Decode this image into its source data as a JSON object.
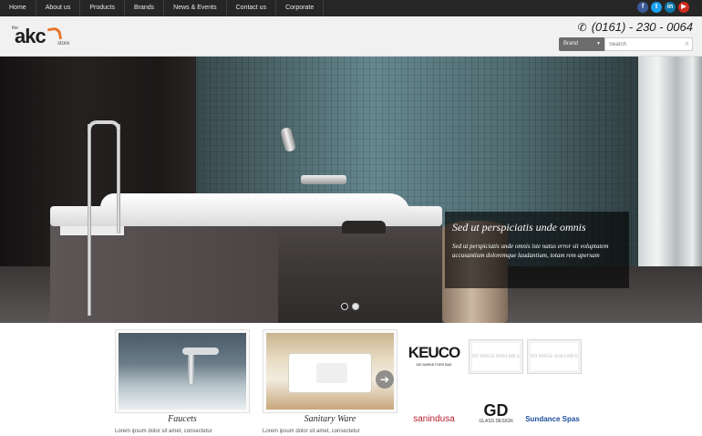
{
  "nav": {
    "items": [
      "Home",
      "About us",
      "Products",
      "Brands",
      "News & Events",
      "Contact us",
      "Corporate"
    ]
  },
  "social": {
    "facebook": "f",
    "twitter": "t",
    "linkedin": "in",
    "youtube": "▶"
  },
  "header": {
    "logo": {
      "the": "the",
      "name": "akc",
      "store": "store"
    },
    "phone": "(0161) - 230 - 0064",
    "brand_select": "Brand",
    "search_placeholder": "Search"
  },
  "hero": {
    "caption_title": "Sed ut perspiciatis unde omnis",
    "caption_text": "Sed ut perspiciatis unde omnis iste natus error sit voluptatem accusantium doloremque laudantium, totam rem apersam",
    "slide_count": 2,
    "active_slide": 1
  },
  "products": [
    {
      "label": "Faucets",
      "desc": "Lorem ipsum dolor sit amet, consectetur"
    },
    {
      "label": "Sanitary Ware",
      "desc": "Lorem ipsum dolor sit amet, consectetur"
    }
  ],
  "brands": {
    "keuco": "KEUCO",
    "keuco_tagline": "DIE MARKE FÜRS BAD",
    "no_image": "NO IMAGE AVAILABLE",
    "sanindusa_a": "san",
    "sanindusa_b": "indusa",
    "gd": "GD",
    "gd_sub": "GLASS DESIGN",
    "sundance": "Sundance Spas"
  },
  "colors": {
    "topbar": "#262626",
    "accent": "#e8742a"
  }
}
